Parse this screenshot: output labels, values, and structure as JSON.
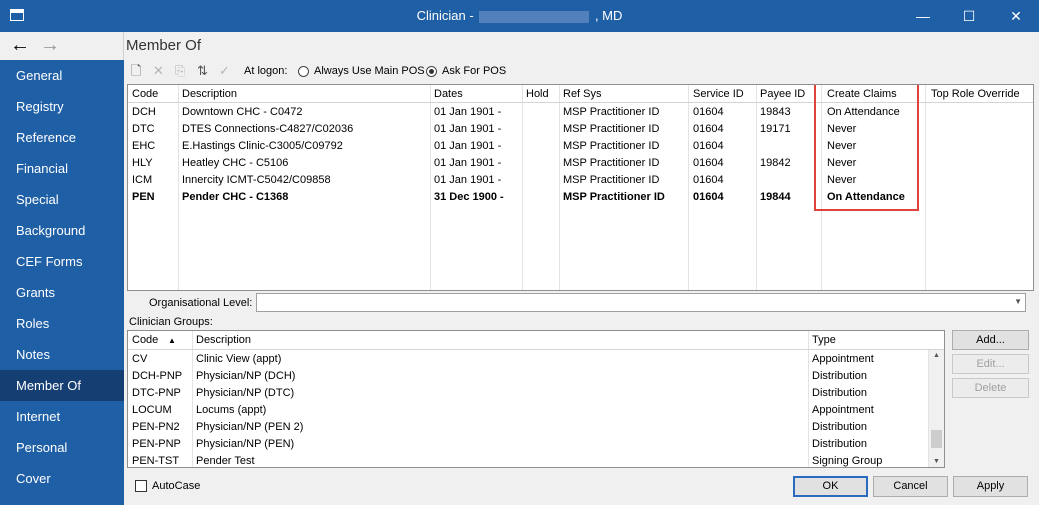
{
  "window": {
    "title_prefix": "Clinician -",
    "title_suffix": ", MD",
    "minimize": "—",
    "maximize": "☐",
    "close": "✕"
  },
  "nav": {
    "back": "←",
    "forward": "→",
    "items": [
      "General",
      "Registry",
      "Reference",
      "Financial",
      "Special",
      "Background",
      "CEF Forms",
      "Grants",
      "Roles",
      "Notes",
      "Member Of",
      "Internet",
      "Personal",
      "Cover"
    ],
    "active": "Member Of"
  },
  "page": {
    "title": "Member Of"
  },
  "toolbar": {
    "icons": [
      "new-icon",
      "delete-icon",
      "copy-icon",
      "refresh-icon",
      "check-icon"
    ],
    "at_logon_label": "At logon:",
    "radio_always": "Always Use Main POS",
    "radio_ask": "Ask For POS",
    "selected": "Ask For POS"
  },
  "member_grid": {
    "columns": [
      "Code",
      "Description",
      "Dates",
      "Hold",
      "Ref Sys",
      "Service ID",
      "Payee ID",
      "Create Claims",
      "Top Role Override"
    ],
    "rows": [
      {
        "code": "DCH",
        "description": "Downtown CHC - C0472",
        "dates": "01 Jan 1901 -",
        "hold": "",
        "ref_sys": "MSP Practitioner ID",
        "service_id": "01604",
        "payee_id": "19843",
        "create_claims": "On Attendance",
        "top_role": "",
        "bold": false
      },
      {
        "code": "DTC",
        "description": "DTES Connections-C4827/C02036",
        "dates": "01 Jan 1901 -",
        "hold": "",
        "ref_sys": "MSP Practitioner ID",
        "service_id": "01604",
        "payee_id": "19171",
        "create_claims": "Never",
        "top_role": "",
        "bold": false
      },
      {
        "code": "EHC",
        "description": "E.Hastings Clinic-C3005/C09792",
        "dates": "01 Jan 1901 -",
        "hold": "",
        "ref_sys": "MSP Practitioner ID",
        "service_id": "01604",
        "payee_id": "",
        "create_claims": "Never",
        "top_role": "",
        "bold": false
      },
      {
        "code": "HLY",
        "description": "Heatley CHC - C5106",
        "dates": "01 Jan 1901 -",
        "hold": "",
        "ref_sys": "MSP Practitioner ID",
        "service_id": "01604",
        "payee_id": "19842",
        "create_claims": "Never",
        "top_role": "",
        "bold": false
      },
      {
        "code": "ICM",
        "description": "Innercity ICMT-C5042/C09858",
        "dates": "01 Jan 1901 -",
        "hold": "",
        "ref_sys": "MSP Practitioner ID",
        "service_id": "01604",
        "payee_id": "",
        "create_claims": "Never",
        "top_role": "",
        "bold": false
      },
      {
        "code": "PEN",
        "description": "Pender CHC - C1368",
        "dates": "31 Dec 1900 -",
        "hold": "",
        "ref_sys": "MSP Practitioner ID",
        "service_id": "01604",
        "payee_id": "19844",
        "create_claims": "On Attendance",
        "top_role": "",
        "bold": true
      }
    ]
  },
  "org_level": {
    "label": "Organisational Level:",
    "value": ""
  },
  "clinician_groups": {
    "label": "Clinician Groups:",
    "columns": [
      "Code",
      "Description",
      "Type"
    ],
    "sort_indicator": "▲",
    "rows": [
      {
        "code": "CV",
        "description": "Clinic View (appt)",
        "type": "Appointment"
      },
      {
        "code": "DCH-PNP",
        "description": "Physician/NP (DCH)",
        "type": "Distribution"
      },
      {
        "code": "DTC-PNP",
        "description": "Physician/NP (DTC)",
        "type": "Distribution"
      },
      {
        "code": "LOCUM",
        "description": "Locums (appt)",
        "type": "Appointment"
      },
      {
        "code": "PEN-PN2",
        "description": "Physician/NP (PEN 2)",
        "type": "Distribution"
      },
      {
        "code": "PEN-PNP",
        "description": "Physician/NP (PEN)",
        "type": "Distribution"
      },
      {
        "code": "PEN-TST",
        "description": "Pender Test",
        "type": "Signing Group"
      }
    ],
    "buttons": {
      "add": "Add...",
      "edit": "Edit...",
      "delete": "Delete"
    }
  },
  "footer": {
    "autocase": "AutoCase",
    "ok": "OK",
    "cancel": "Cancel",
    "apply": "Apply"
  },
  "colors": {
    "titlebar": "#1f5fa6",
    "nav_active": "#153f73",
    "highlight_box": "#e0433a"
  }
}
